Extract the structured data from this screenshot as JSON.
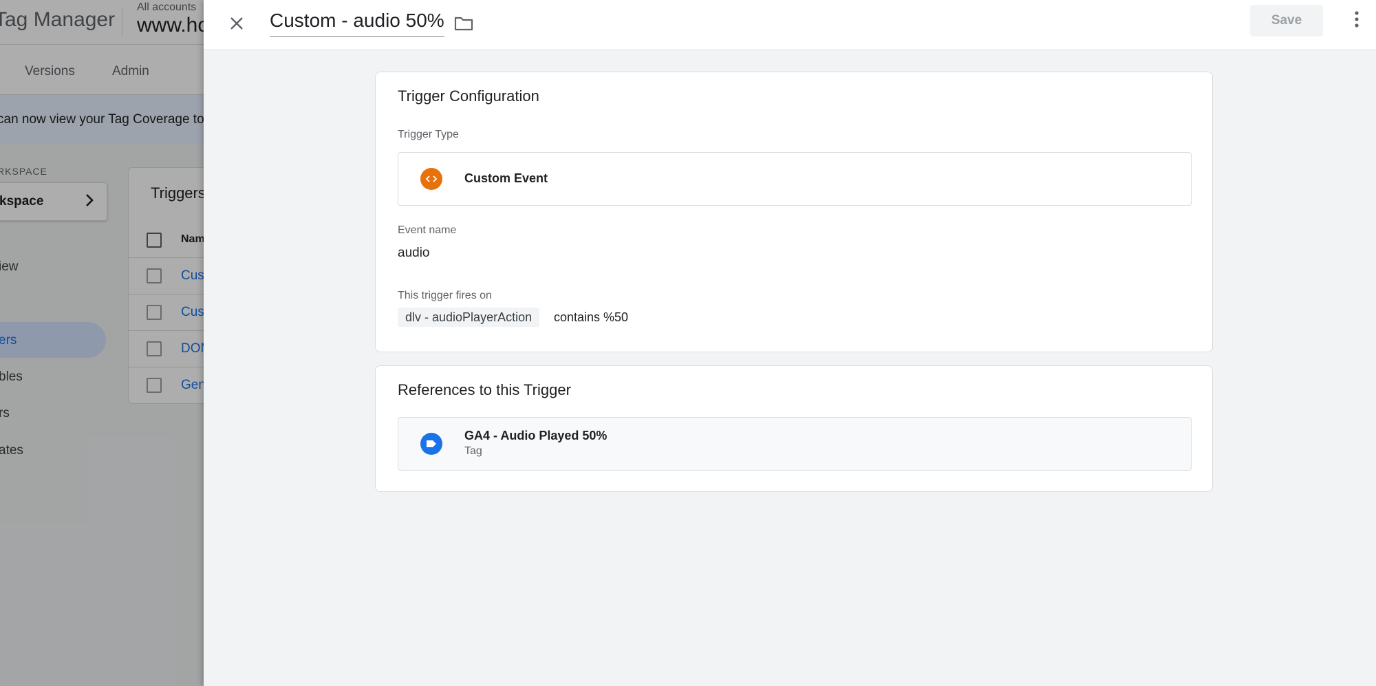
{
  "background": {
    "product_title": "Tag Manager",
    "accounts_breadcrumb": "All accounts",
    "container_name": "www.ho",
    "nav_tabs": [
      "Versions",
      "Admin"
    ],
    "banner_text": "can now view your Tag Coverage to",
    "workspace_label": "RKSPACE",
    "workspace_button": "kspace",
    "sidebar_items": [
      "iew",
      "ers",
      "bles",
      "rs",
      "ates"
    ],
    "card_title": "Triggers",
    "column_name": "Nam",
    "rows": [
      "Cus",
      "Cus",
      "DOM",
      "Gen"
    ]
  },
  "sheet": {
    "title": "Custom - audio 50%",
    "save_label": "Save",
    "trigger_configuration": {
      "heading": "Trigger Configuration",
      "type_label": "Trigger Type",
      "type_name": "Custom Event",
      "type_icon": "code-brackets-icon",
      "type_icon_color": "#e8710a",
      "event_name_label": "Event name",
      "event_name_value": "audio",
      "fires_on_label": "This trigger fires on",
      "condition": {
        "variable": "dlv - audioPlayerAction",
        "operator_and_value": "contains %50"
      }
    },
    "references": {
      "heading": "References to this Trigger",
      "items": [
        {
          "name": "GA4 - Audio Played 50%",
          "kind": "Tag",
          "icon": "tag-icon",
          "icon_color": "#1a73e8"
        }
      ]
    }
  },
  "colors": {
    "accent": "#1a73e8",
    "custom_event": "#e8710a",
    "active_nav": "#d2e3fc"
  }
}
